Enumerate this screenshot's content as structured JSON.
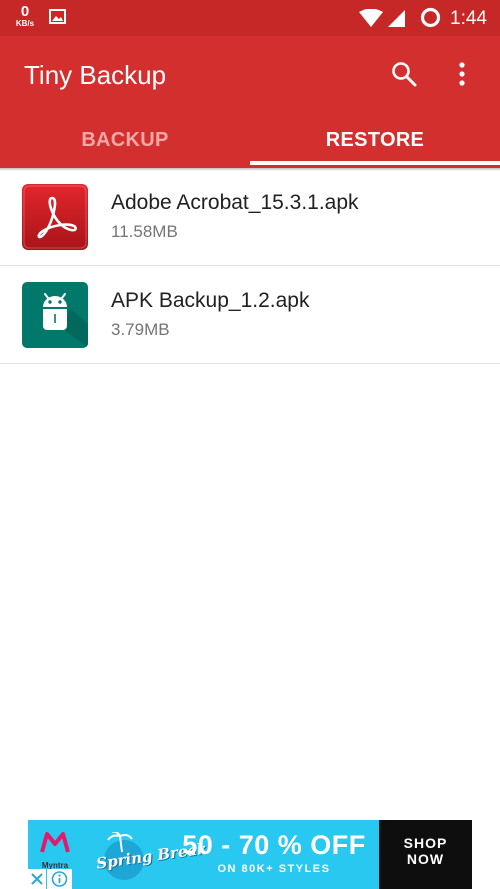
{
  "status_bar": {
    "net_speed_value": "0",
    "net_speed_unit": "KB/s",
    "time": "1:44",
    "icons": [
      "image-notification-icon",
      "wifi-icon",
      "signal-icon",
      "battery-ring-icon"
    ]
  },
  "app_bar": {
    "title": "Tiny Backup",
    "actions": [
      "search-icon",
      "more-options-icon"
    ]
  },
  "tabs": [
    {
      "label": "BACKUP",
      "selected": false
    },
    {
      "label": "RESTORE",
      "selected": true
    }
  ],
  "files": [
    {
      "name": "Adobe Acrobat_15.3.1.apk",
      "size": "11.58MB",
      "icon": "adobe-acrobat-icon"
    },
    {
      "name": "APK Backup_1.2.apk",
      "size": "3.79MB",
      "icon": "android-robot-icon"
    }
  ],
  "ad": {
    "brand": "Myntra",
    "event": "Spring Break",
    "headline": "50 - 70 % OFF",
    "subline": "ON 80K+ STYLES",
    "cta_line1": "SHOP",
    "cta_line2": "NOW"
  },
  "colors": {
    "status_bar": "#c62828",
    "app_bar": "#d32f2f",
    "tab_inactive": "#f4a9a6",
    "ad_background": "#29c8f0",
    "apk_icon_bg": "#00796b",
    "acrobat_icon_bg": "#c4161c"
  }
}
